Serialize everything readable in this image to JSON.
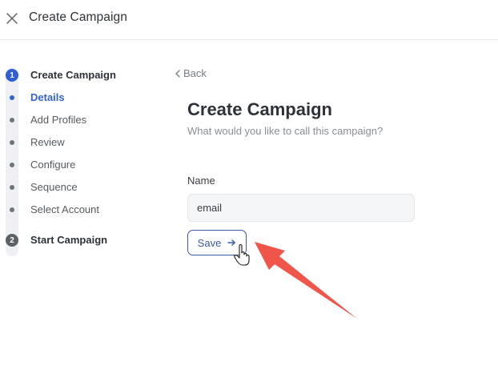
{
  "header": {
    "title": "Create Campaign",
    "close_icon": "close-icon"
  },
  "stepper": {
    "steps": [
      {
        "number": "1",
        "label": "Create Campaign",
        "substeps": [
          {
            "label": "Details",
            "active": true
          },
          {
            "label": "Add Profiles",
            "active": false
          },
          {
            "label": "Review",
            "active": false
          },
          {
            "label": "Configure",
            "active": false
          },
          {
            "label": "Sequence",
            "active": false
          },
          {
            "label": "Select Account",
            "active": false
          }
        ]
      },
      {
        "number": "2",
        "label": "Start Campaign",
        "substeps": []
      }
    ]
  },
  "main": {
    "back_label": "Back",
    "title": "Create Campaign",
    "subtitle": "What would you like to call this campaign?",
    "name_label": "Name",
    "name_value": "email",
    "save_label": "Save",
    "save_icon": "arrow-right-icon"
  },
  "colors": {
    "accent": "#3463d6",
    "annotation_arrow": "#f0554a"
  }
}
